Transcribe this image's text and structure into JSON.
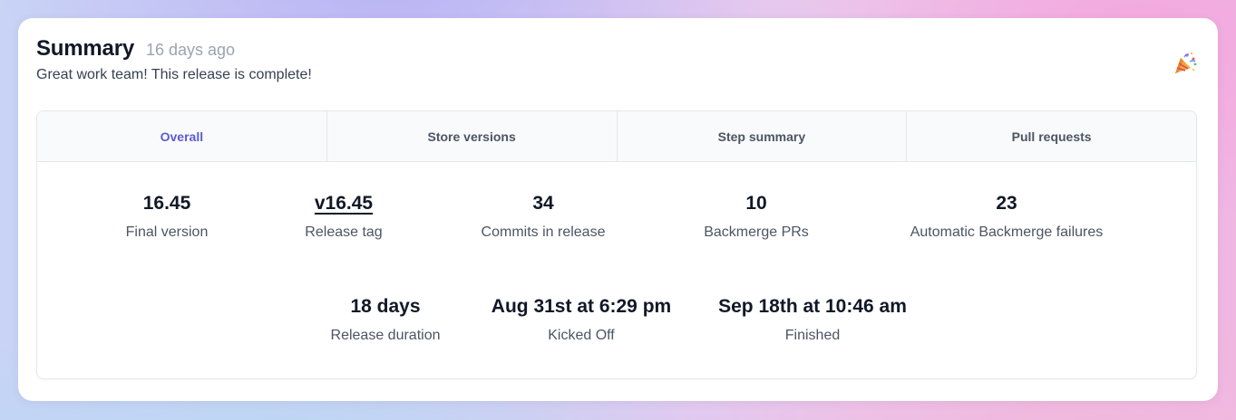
{
  "summary": {
    "title": "Summary",
    "time_ago": "16 days ago",
    "message": "Great work team! This release is complete!",
    "icon": "party-popper-icon"
  },
  "tabs": [
    {
      "label": "Overall",
      "active": true
    },
    {
      "label": "Store versions",
      "active": false
    },
    {
      "label": "Step summary",
      "active": false
    },
    {
      "label": "Pull requests",
      "active": false
    }
  ],
  "stats_row1": [
    {
      "value": "16.45",
      "label": "Final version"
    },
    {
      "value": "v16.45",
      "label": "Release tag",
      "is_link": true
    },
    {
      "value": "34",
      "label": "Commits in release"
    },
    {
      "value": "10",
      "label": "Backmerge PRs"
    },
    {
      "value": "23",
      "label": "Automatic Backmerge failures"
    }
  ],
  "stats_row2": [
    {
      "value": "18 days",
      "label": "Release duration"
    },
    {
      "value": "Aug 31st at 6:29 pm",
      "label": "Kicked Off"
    },
    {
      "value": "Sep 18th at 10:46 am",
      "label": "Finished"
    }
  ],
  "colors": {
    "accent": "#5b5bd6",
    "text_primary": "#111827",
    "text_muted": "#9ca3af"
  }
}
